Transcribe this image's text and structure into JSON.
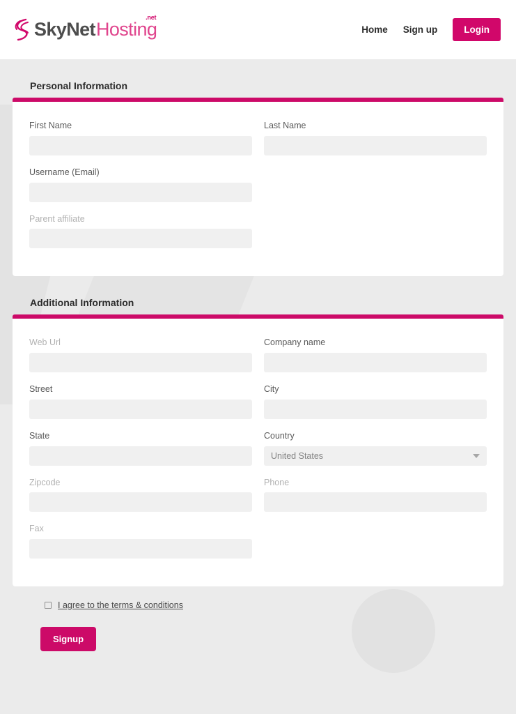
{
  "brand": {
    "logo_sky": "SkyNet",
    "logo_hosting": "Hosting",
    "logo_net": ".net",
    "accent_pink": "#cc0a68",
    "logo_gray": "#4d4d4d",
    "page_bg": "#ebebeb",
    "input_bg": "#f0f0f0"
  },
  "nav": {
    "home": "Home",
    "signup": "Sign up",
    "login": "Login"
  },
  "personal_section": {
    "title": "Personal Information",
    "fields": [
      {
        "label": "First Name",
        "value": "",
        "placeholder": "",
        "optional": false
      },
      {
        "label": "Last Name",
        "value": "",
        "placeholder": "",
        "optional": false
      },
      {
        "label": "Username (Email)",
        "value": "",
        "placeholder": "",
        "optional": false
      },
      {
        "label": "Parent affiliate",
        "value": "",
        "placeholder": "",
        "optional": true
      }
    ]
  },
  "additional_section": {
    "title": "Additional Information",
    "fields": [
      {
        "label": "Web Url",
        "value": "",
        "placeholder": "",
        "optional": true
      },
      {
        "label": "Company name",
        "value": "",
        "placeholder": "",
        "optional": false
      },
      {
        "label": "Street",
        "value": "",
        "placeholder": "",
        "optional": false
      },
      {
        "label": "City",
        "value": "",
        "placeholder": "",
        "optional": false
      },
      {
        "label": "State",
        "value": "",
        "placeholder": "",
        "optional": false
      },
      {
        "label": "Zipcode",
        "value": "",
        "placeholder": "",
        "optional": true
      },
      {
        "label": "Phone",
        "value": "",
        "placeholder": "",
        "optional": true
      },
      {
        "label": "Fax",
        "value": "",
        "placeholder": "",
        "optional": true
      }
    ],
    "country": {
      "label": "Country",
      "selected": "United States",
      "options": [
        "United States"
      ]
    }
  },
  "terms": {
    "checked": false,
    "link_text": "I agree to the terms & conditions"
  },
  "submit": {
    "label": "Signup"
  }
}
